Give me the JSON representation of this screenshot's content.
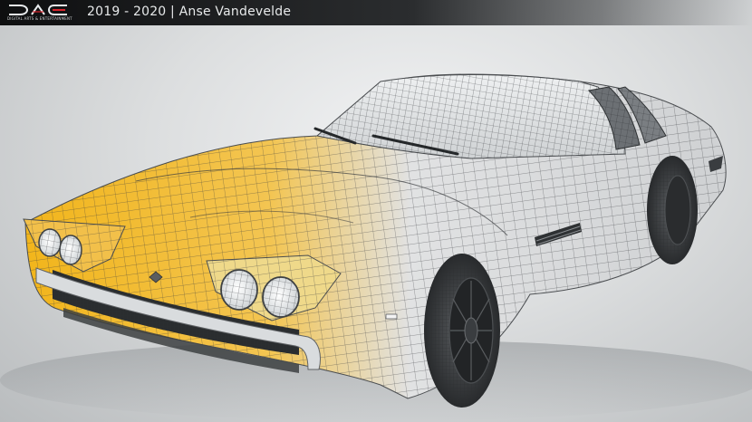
{
  "header": {
    "logo_text": "DIGITAL ARTS & ENTERTAINMENT",
    "title": "2019 - 2020  |  Anse Vandevelde"
  },
  "colors": {
    "accent_yellow": "#f2b51b",
    "wireframe_line": "#3a3d40",
    "background_light": "#f2f3f4",
    "header_dark": "#0e0f10",
    "logo_red": "#d9242b"
  },
  "scene": {
    "subject": "car-wireframe-render"
  }
}
